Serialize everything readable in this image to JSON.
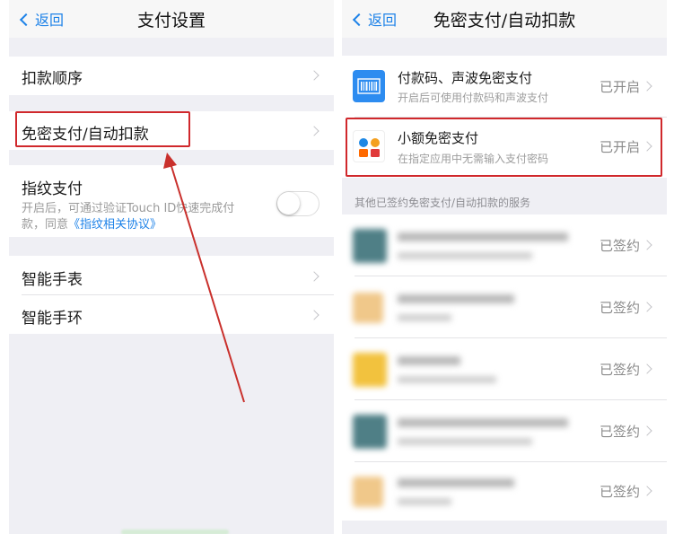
{
  "left": {
    "nav": {
      "back": "返回",
      "title": "支付设置"
    },
    "items": {
      "deduction_order": "扣款顺序",
      "password_free": "免密支付/自动扣款",
      "fingerprint": {
        "title": "指纹支付",
        "desc_line1": "开启后，可通过验证Touch ID快速完成付",
        "desc_line2_prefix": "款，同意",
        "desc_link": "《指纹相关协议》",
        "toggle_on": false
      },
      "smart_watch": "智能手表",
      "smart_band": "智能手环"
    }
  },
  "right": {
    "nav": {
      "back": "返回",
      "title": "免密支付/自动扣款"
    },
    "services": [
      {
        "title": "付款码、声波免密支付",
        "subtitle": "开启后可使用付款码和声波支付",
        "status": "已开启",
        "icon": "barcode-icon"
      },
      {
        "title": "小额免密支付",
        "subtitle": "在指定应用中无需输入支付密码",
        "status": "已开启",
        "icon": "small-payment-apps-icon"
      }
    ],
    "section_header": "其他已签约免密支付/自动扣款的服务",
    "signed_services": [
      {
        "status": "已签约"
      },
      {
        "status": "已签约"
      },
      {
        "status": "已签约"
      },
      {
        "status": "已签约"
      },
      {
        "status": "已签约"
      }
    ]
  },
  "colors": {
    "accent": "#1d82e8",
    "highlight": "#d0282c",
    "background": "#efeff4"
  }
}
